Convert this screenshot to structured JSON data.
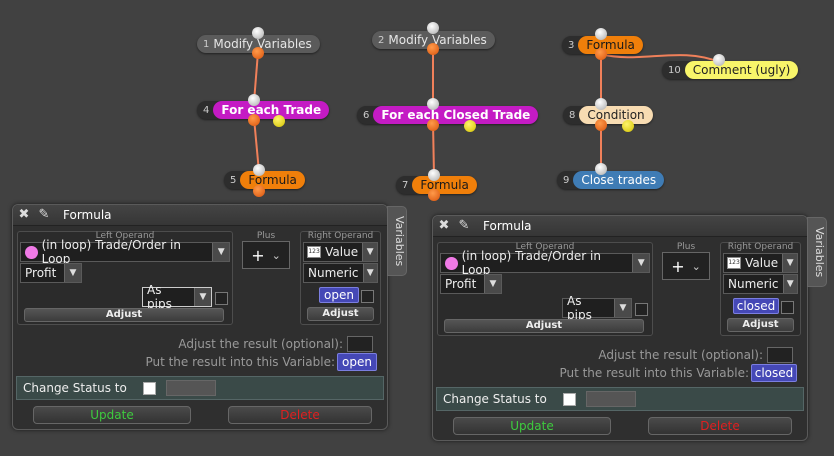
{
  "nodes": [
    {
      "num": "1",
      "label": "Modify Variables"
    },
    {
      "num": "4",
      "label": "For each Trade"
    },
    {
      "num": "5",
      "label": "Formula"
    },
    {
      "num": "2",
      "label": "Modify Variables"
    },
    {
      "num": "6",
      "label": "For each Closed Trade"
    },
    {
      "num": "7",
      "label": "Formula"
    },
    {
      "num": "3",
      "label": "Formula"
    },
    {
      "num": "10",
      "label": "Comment (ugly)"
    },
    {
      "num": "8",
      "label": "Condition"
    },
    {
      "num": "9",
      "label": "Close trades"
    }
  ],
  "panels": [
    {
      "title": "Formula",
      "side_tab": "Variables",
      "left_caption": "Left Operand",
      "left_operand": "(in loop) Trade/Order in Loop",
      "left_sub": "Profit",
      "left_unit": "As pips",
      "left_adjust": "Adjust",
      "plus_caption": "Plus",
      "plus_symbol": "+",
      "right_caption": "Right Operand",
      "right_kind": "Value",
      "right_type": "Numeric",
      "right_value": "open",
      "right_adjust": "Adjust",
      "adjust_label": "Adjust the result (optional):",
      "result_label": "Put the result into this Variable:",
      "result_var": "open",
      "status_label": "Change Status to",
      "update": "Update",
      "delete": "Delete"
    },
    {
      "title": "Formula",
      "side_tab": "Variables",
      "left_caption": "Left Operand",
      "left_operand": "(in loop) Trade/Order in Loop",
      "left_sub": "Profit",
      "left_unit": "As pips",
      "left_adjust": "Adjust",
      "plus_caption": "Plus",
      "plus_symbol": "+",
      "right_caption": "Right Operand",
      "right_kind": "Value",
      "right_type": "Numeric",
      "right_value": "closed",
      "right_adjust": "Adjust",
      "adjust_label": "Adjust the result (optional):",
      "result_label": "Put the result into this Variable:",
      "result_var": "closed",
      "status_label": "Change Status to",
      "update": "Update",
      "delete": "Delete"
    }
  ],
  "colors": {
    "background": "#414141",
    "update": "#3ecb3e",
    "delete": "#e02020",
    "variable_pill": "#4548b6"
  }
}
